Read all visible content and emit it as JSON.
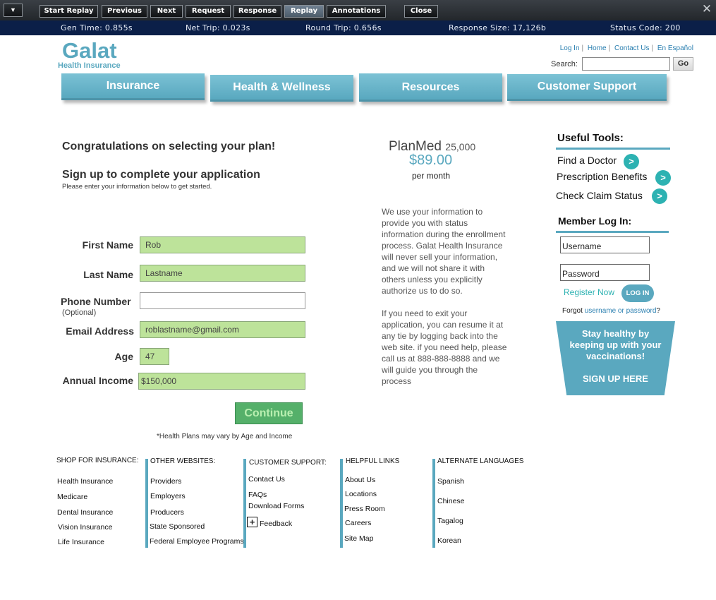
{
  "toolbar": {
    "buttons": [
      {
        "label": "Start Replay"
      },
      {
        "label": "Previous"
      },
      {
        "label": "Next"
      },
      {
        "label": "Request"
      },
      {
        "label": "Response"
      },
      {
        "label": "Replay",
        "active": true
      },
      {
        "label": "Annotations"
      },
      {
        "label": "Close"
      }
    ]
  },
  "status": {
    "gen_time": "Gen Time: 0.855s",
    "net_trip": "Net Trip: 0.023s",
    "round_trip": "Round Trip: 0.656s",
    "response_size": "Response Size: 17,126b",
    "status_code": "Status Code: 200"
  },
  "header": {
    "logo": "Galat",
    "logo_sub": "Health Insurance",
    "links": [
      "Log In",
      "Home",
      "Contact Us",
      "En Español"
    ],
    "search_label": "Search:",
    "search_value": "",
    "go_label": "Go"
  },
  "nav": [
    "Insurance",
    "Health & Wellness",
    "Resources",
    "Customer Support"
  ],
  "form": {
    "congrats": "Congratulations on selecting your plan!",
    "signup": "Sign up to complete your application",
    "please": "Please enter your information below to get started.",
    "first_name_label": "First Name",
    "first_name_value": "Rob",
    "last_name_label": "Last Name",
    "last_name_value": "Lastname",
    "phone_label": "Phone Number",
    "phone_optional": "(Optional)",
    "phone_value": "",
    "email_label": "Email Address",
    "email_value": "roblastname@gmail.com",
    "age_label": "Age",
    "age_value": "47",
    "income_label": "Annual Income",
    "income_value": "$150,000",
    "continue_label": "Continue",
    "footnote": "*Health Plans may vary by Age and Income"
  },
  "plan": {
    "name": "PlanMed",
    "amount": "25,000",
    "price": "$89.00",
    "per": "per month",
    "info_1": "We use your information to provide you with status information during the enrollment process. Galat Health Insurance will never sell your information, and we will not share it with others unless you explicitly authorize us to do so.",
    "info_2": "If you need to exit your application, you can resume it at any tie by logging back into the web site. if you need help, please call us at 888-888-8888 and we will guide you through the process"
  },
  "tools": {
    "heading": "Useful Tools:",
    "items": [
      "Find a Doctor",
      "Prescription Benefits",
      "Check Claim Status"
    ]
  },
  "member": {
    "heading": "Member Log In:",
    "username_placeholder": "Username",
    "password_placeholder": "Password",
    "register": "Register Now",
    "login_button": "LOG IN",
    "forgot_prefix": "Forgot ",
    "forgot_link": "username or password",
    "forgot_suffix": "?"
  },
  "promo": {
    "text": "Stay healthy by keeping up with your vaccinations!",
    "cta": "SIGN UP HERE"
  },
  "footer": {
    "shop_heading": "SHOP FOR INSURANCE:",
    "shop_items": [
      "Health Insurance",
      "Medicare",
      "Dental Insurance",
      "Vision Insurance",
      "Life Insurance"
    ],
    "other_heading": "OTHER WEBSITES:",
    "other_items": [
      "Providers",
      "Employers",
      "Producers",
      "State Sponsored",
      "Federal Employee Programs"
    ],
    "support_heading": "CUSTOMER SUPPORT:",
    "support_items": [
      "Contact Us",
      "FAQs",
      "Download Forms",
      "Feedback"
    ],
    "helpful_heading": "HELPFUL LINKS",
    "helpful_items": [
      "About Us",
      "Locations",
      "Press Room",
      "Careers",
      "Site Map"
    ],
    "lang_heading": "ALTERNATE LANGUAGES",
    "lang_items": [
      "Spanish",
      "Chinese",
      "Tagalog",
      "Korean"
    ]
  },
  "colors": {
    "brand": "#5aa8bf",
    "field_fill": "#bde39a",
    "continue": "#55b06a",
    "toolbar_bg": "#23272b",
    "status_bg": "#0b1f48"
  }
}
